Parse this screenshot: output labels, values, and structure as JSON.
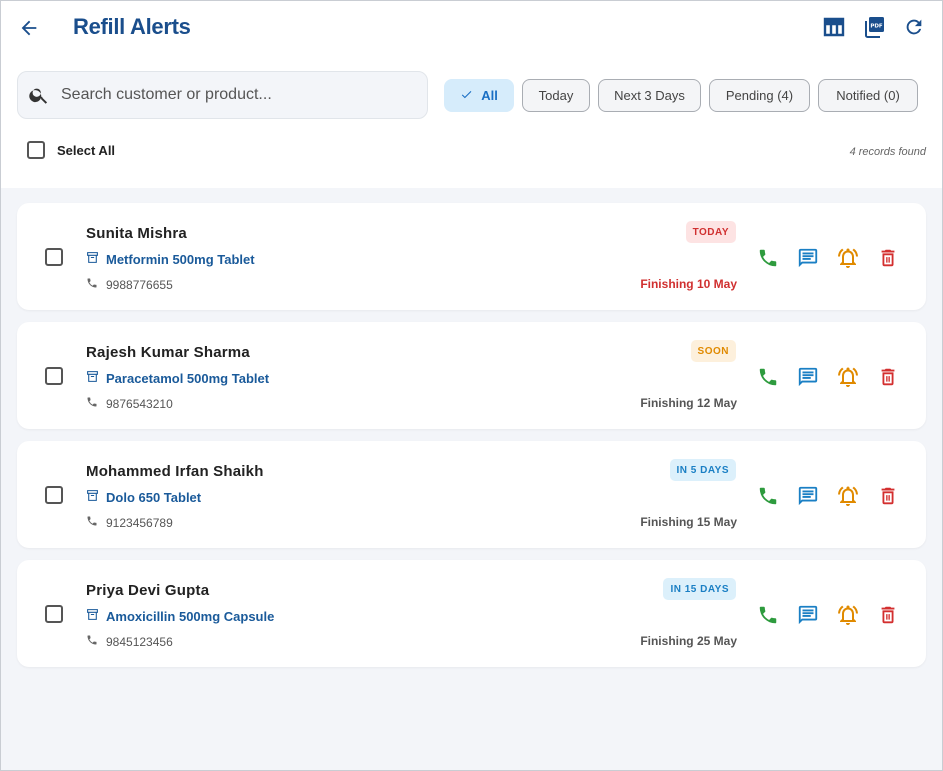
{
  "header": {
    "title": "Refill Alerts",
    "icons": [
      "back-arrow-icon",
      "table-icon",
      "pdf-icon",
      "refresh-icon"
    ],
    "pdf_label": "PDF"
  },
  "search": {
    "placeholder": "Search customer or product...",
    "value": ""
  },
  "filters": [
    {
      "label": "All",
      "active": true
    },
    {
      "label": "Today",
      "active": false
    },
    {
      "label": "Next 3 Days",
      "active": false
    },
    {
      "label": "Pending (4)",
      "active": false
    },
    {
      "label": "Notified (0)",
      "active": false
    }
  ],
  "select_all_label": "Select All",
  "records_text": "4 records found",
  "colors": {
    "accent": "#1a4e8c",
    "call": "#2e9b3e",
    "message": "#1a7fc4",
    "notify": "#e08a00",
    "delete": "#d32f2f"
  },
  "alerts": [
    {
      "name": "Sunita Mishra",
      "product": "Metformin 500mg Tablet",
      "phone": "9988776655",
      "badge": "TODAY",
      "badge_bg": "#fde3e3",
      "badge_color": "#d03030",
      "finishing": "Finishing 10 May",
      "finishing_color": "#d03030"
    },
    {
      "name": "Rajesh Kumar Sharma",
      "product": "Paracetamol 500mg Tablet",
      "phone": "9876543210",
      "badge": "SOON",
      "badge_bg": "#fdf0dc",
      "badge_color": "#e08a00",
      "finishing": "Finishing 12 May",
      "finishing_color": "#555555"
    },
    {
      "name": "Mohammed Irfan Shaikh",
      "product": "Dolo 650 Tablet",
      "phone": "9123456789",
      "badge": "IN 5 DAYS",
      "badge_bg": "#dcf0fb",
      "badge_color": "#1a7fc4",
      "finishing": "Finishing 15 May",
      "finishing_color": "#555555"
    },
    {
      "name": "Priya Devi Gupta",
      "product": "Amoxicillin 500mg Capsule",
      "phone": "9845123456",
      "badge": "IN 15 DAYS",
      "badge_bg": "#dcf0fb",
      "badge_color": "#1a7fc4",
      "finishing": "Finishing 25 May",
      "finishing_color": "#555555"
    }
  ]
}
